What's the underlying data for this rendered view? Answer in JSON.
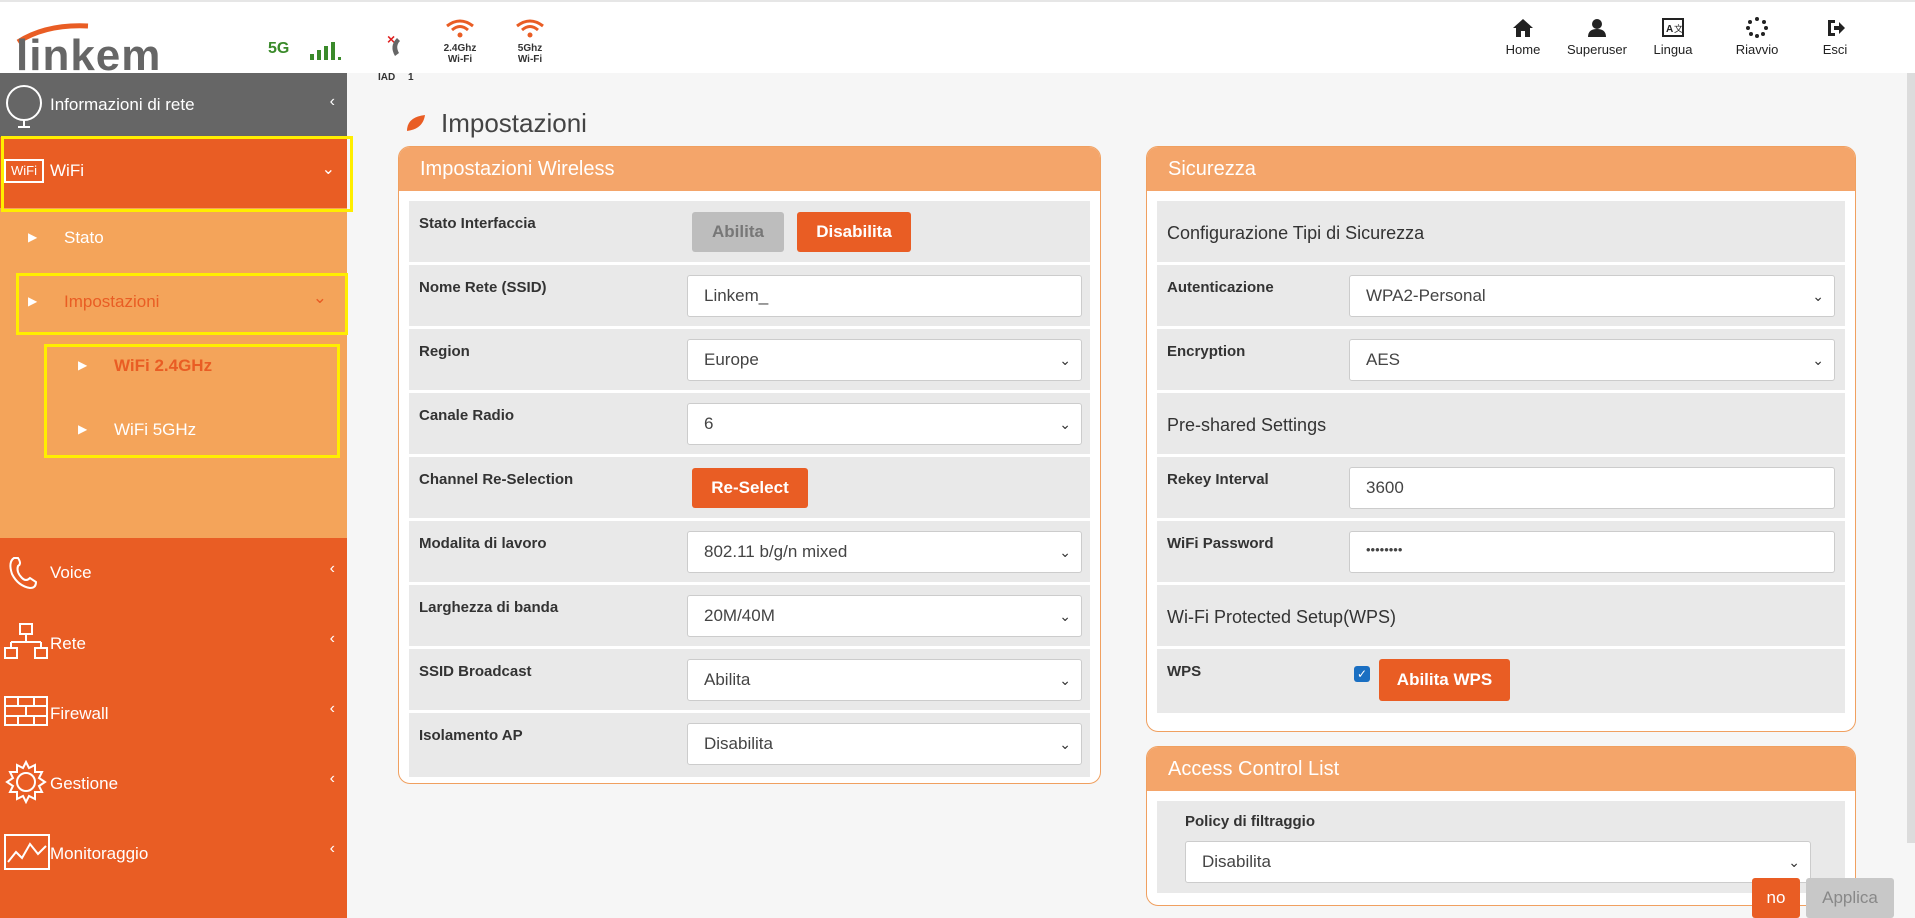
{
  "header": {
    "logo_text": "linkem",
    "status": {
      "network_label": "5G",
      "iad_label": "IAD",
      "iad_count": "1",
      "wifi24_line1": "2.4Ghz",
      "wifi24_line2": "Wi-Fi",
      "wifi5_line1": "5Ghz",
      "wifi5_line2": "Wi-Fi"
    },
    "nav": [
      {
        "label": "Home",
        "icon": "home-icon"
      },
      {
        "label": "Superuser",
        "icon": "user-icon"
      },
      {
        "label": "Lingua",
        "icon": "language-icon"
      },
      {
        "label": "Riavvio",
        "icon": "restart-icon"
      },
      {
        "label": "Esci",
        "icon": "logout-icon"
      }
    ]
  },
  "sidebar": {
    "network_info": "Informazioni di rete",
    "wifi": "WiFi",
    "wifi_icon_text": "WiFi",
    "stato": "Stato",
    "impostazioni": "Impostazioni",
    "wifi24": "WiFi 2.4GHz",
    "wifi5": "WiFi 5GHz",
    "voice": "Voice",
    "rete": "Rete",
    "firewall": "Firewall",
    "gestione": "Gestione",
    "monitoraggio": "Monitoraggio",
    "colors": {
      "orange": "#e95d24",
      "light_orange": "#f4a45a",
      "grey": "#666666",
      "highlight": "#ffee00"
    }
  },
  "page": {
    "title": "Impostazioni"
  },
  "wireless": {
    "title": "Impostazioni Wireless",
    "rows": {
      "interface_label": "Stato Interfaccia",
      "enable_btn": "Abilita",
      "disable_btn": "Disabilita",
      "ssid_label": "Nome Rete (SSID)",
      "ssid_value": "Linkem_",
      "region_label": "Region",
      "region_value": "Europe",
      "channel_label": "Canale Radio",
      "channel_value": "6",
      "reselect_label": "Channel Re-Selection",
      "reselect_btn": "Re-Select",
      "mode_label": "Modalita di lavoro",
      "mode_value": "802.11 b/g/n mixed",
      "bandwidth_label": "Larghezza di banda",
      "bandwidth_value": "20M/40M",
      "broadcast_label": "SSID Broadcast",
      "broadcast_value": "Abilita",
      "isolation_label": "Isolamento AP",
      "isolation_value": "Disabilita"
    }
  },
  "security": {
    "title": "Sicurezza",
    "section1": "Configurazione Tipi di Sicurezza",
    "auth_label": "Autenticazione",
    "auth_value": "WPA2-Personal",
    "enc_label": "Encryption",
    "enc_value": "AES",
    "section2": "Pre-shared Settings",
    "rekey_label": "Rekey Interval",
    "rekey_value": "3600",
    "password_label": "WiFi Password",
    "password_value": "••••••••",
    "section3": "Wi-Fi Protected Setup(WPS)",
    "wps_label": "WPS",
    "wps_btn": "Abilita WPS",
    "wps_checked": true
  },
  "acl": {
    "title": "Access Control List",
    "policy_label": "Policy di filtraggio",
    "policy_value": "Disabilita"
  },
  "footer": {
    "no_btn": "no",
    "apply_btn": "Applica"
  }
}
